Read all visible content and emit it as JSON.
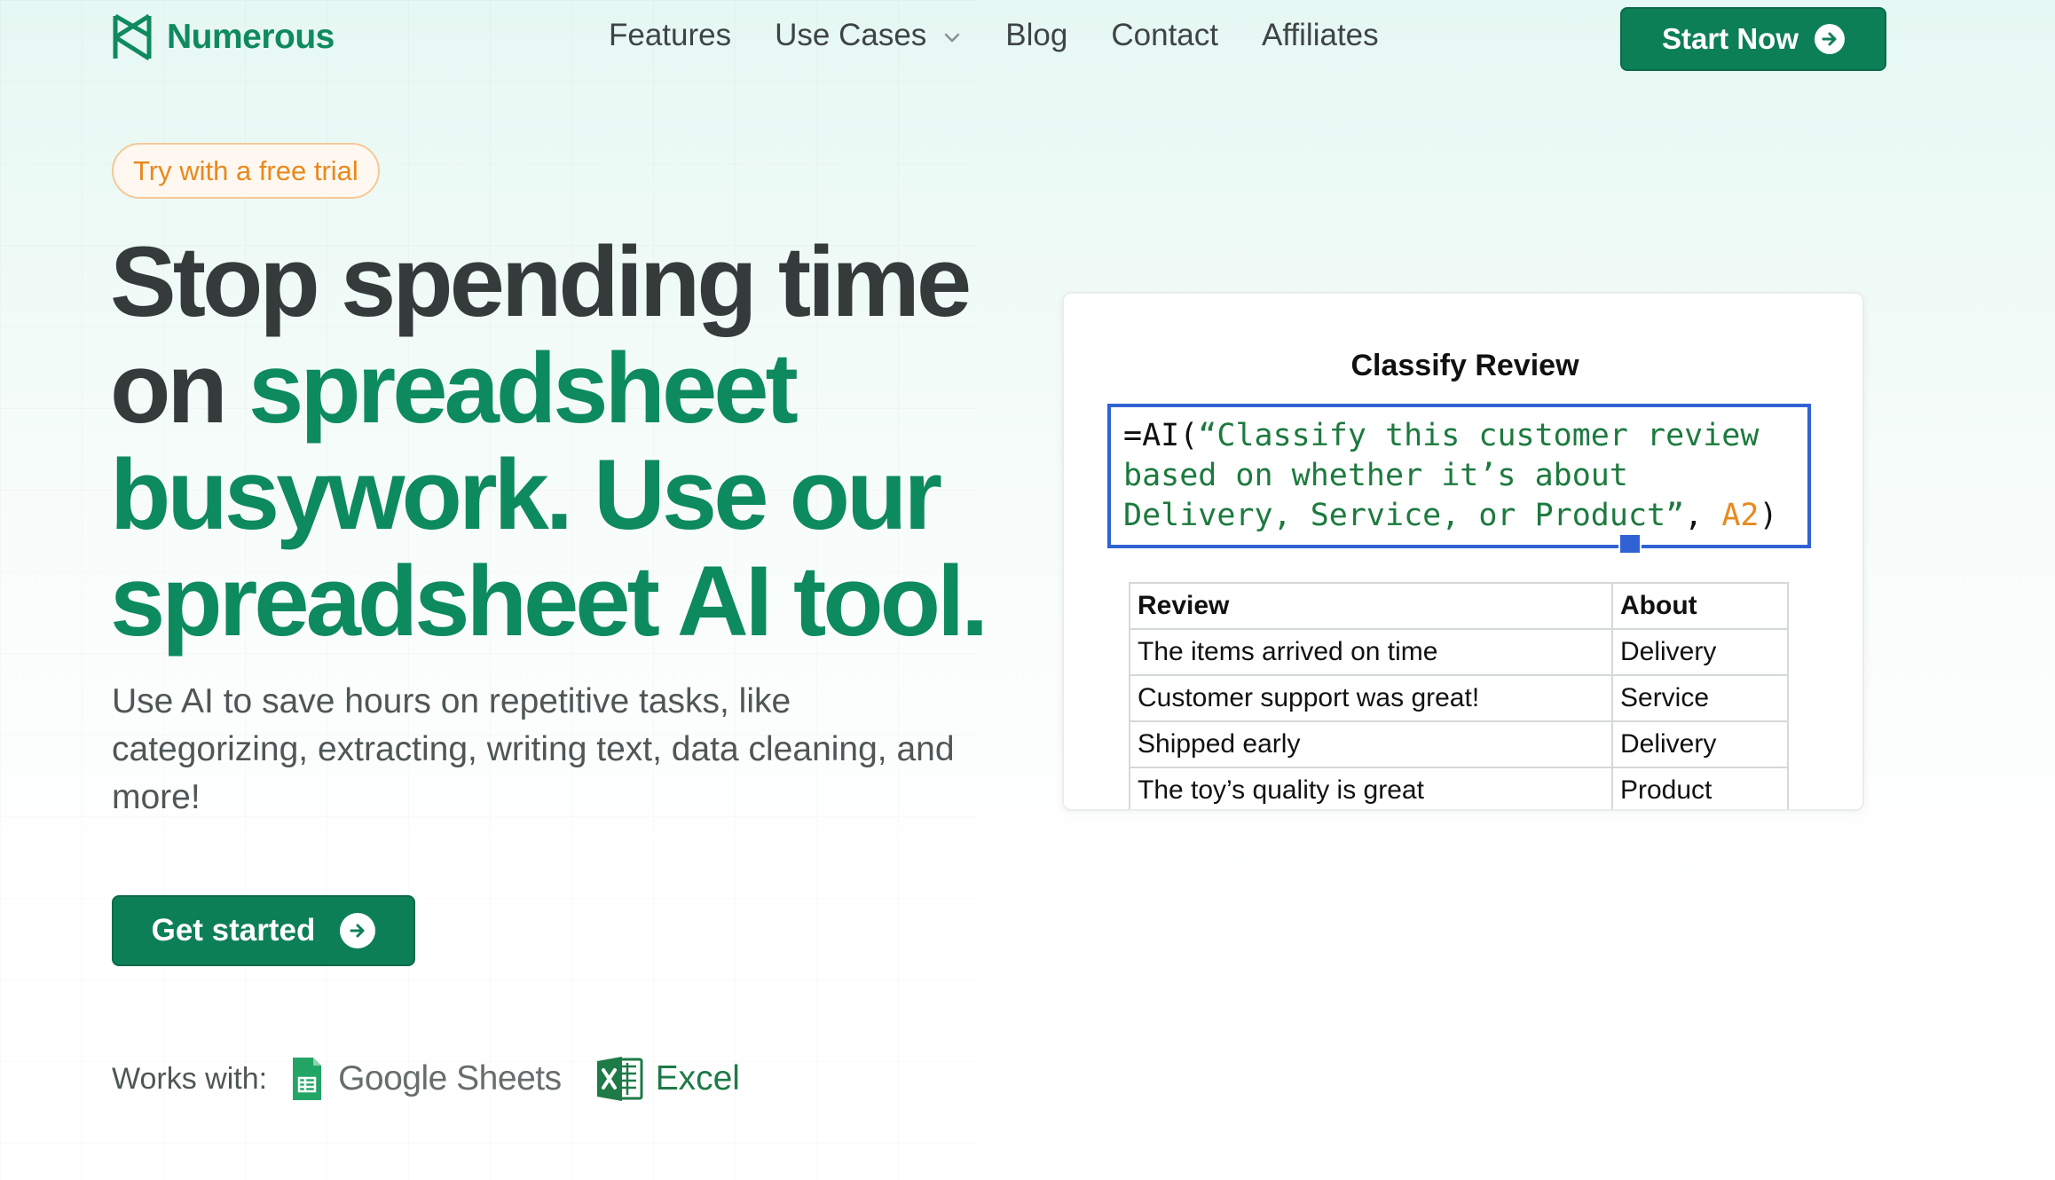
{
  "nav": {
    "brand": "Numerous",
    "links": [
      {
        "label": "Features"
      },
      {
        "label": "Use Cases",
        "has_dropdown": true
      },
      {
        "label": "Blog"
      },
      {
        "label": "Contact"
      },
      {
        "label": "Affiliates"
      }
    ],
    "cta_label": "Start Now"
  },
  "hero": {
    "badge": "Try with a free trial",
    "headline_part1": "Stop spending time on ",
    "headline_part2": "spreadsheet busywork. Use our spreadsheet AI tool.",
    "subtitle": "Use AI to save hours on repetitive tasks, like categorizing, extracting, writing text, data cleaning, and more!",
    "cta_label": "Get started",
    "works_with_label": "Works with:",
    "integrations": [
      {
        "name": "Google Sheets",
        "icon": "google-sheets-icon"
      },
      {
        "name": "Excel",
        "icon": "excel-icon"
      }
    ]
  },
  "demo": {
    "title": "Classify Review",
    "formula_prefix": "=AI(",
    "formula_string": "“Classify this customer review based on whether it’s about Delivery, Service, or Product”",
    "formula_sep": ", ",
    "formula_ref": "A2",
    "formula_close": ")",
    "table": {
      "headers": [
        "Review",
        "About"
      ],
      "rows": [
        [
          "The items arrived on time",
          "Delivery"
        ],
        [
          "Customer support was great!",
          "Service"
        ],
        [
          "Shipped early",
          "Delivery"
        ],
        [
          "The toy’s quality is great",
          "Product"
        ]
      ]
    }
  },
  "colors": {
    "brand_green": "#0d7f56",
    "accent_orange": "#e8891e",
    "formula_border": "#2f63d3"
  }
}
